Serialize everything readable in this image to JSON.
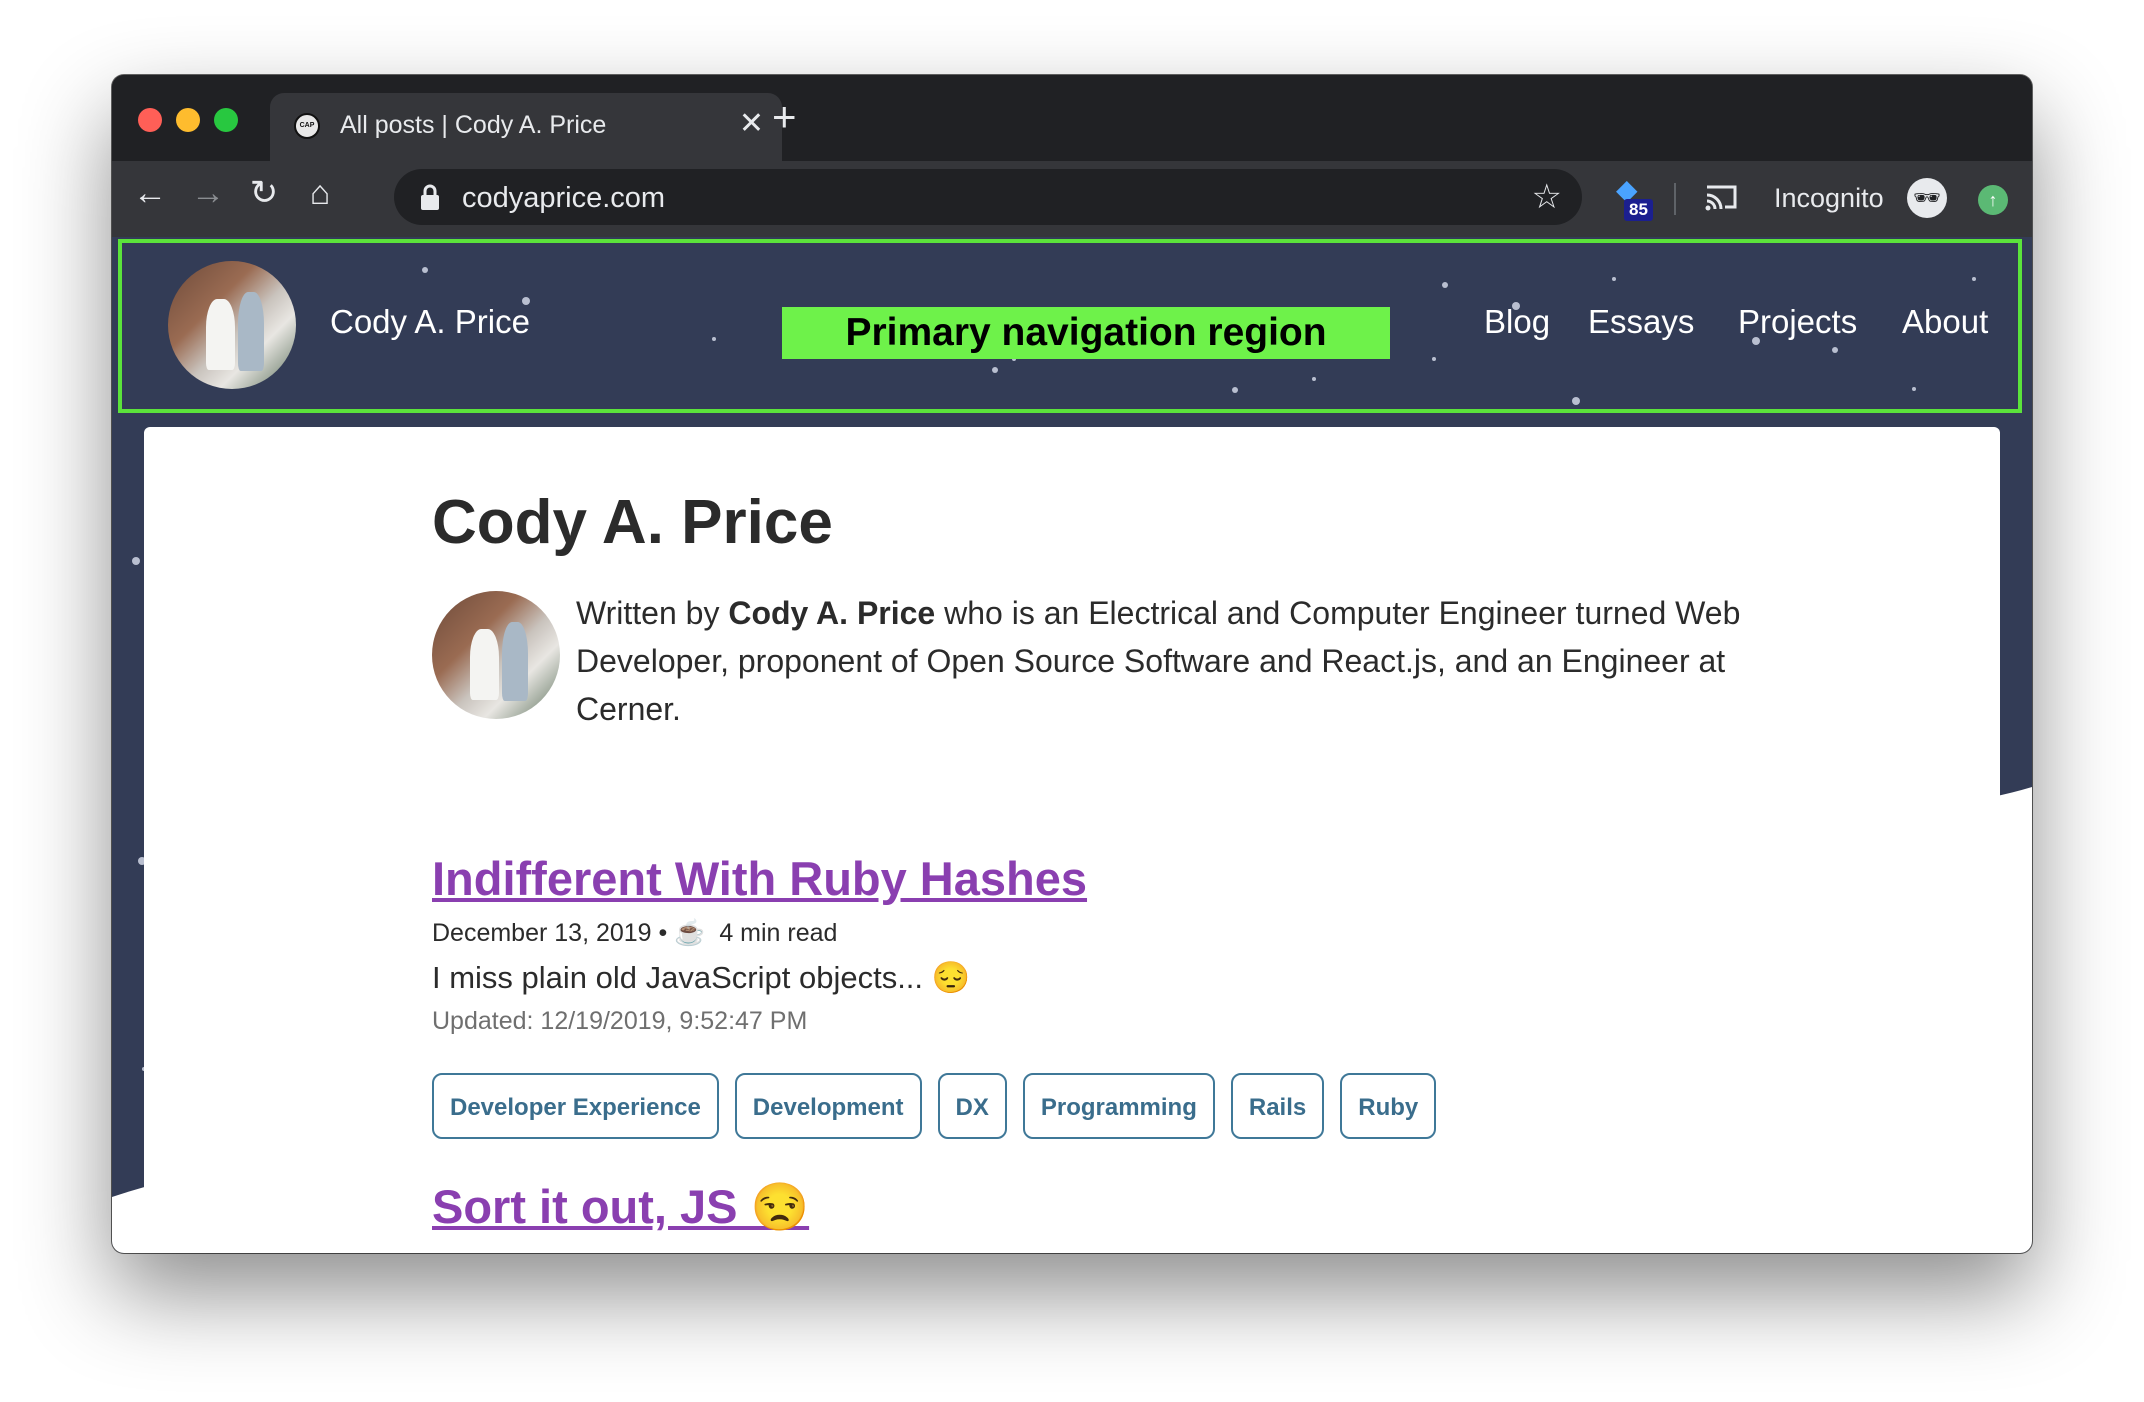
{
  "browser": {
    "tab_title": "All posts | Cody A. Price",
    "favicon_text": "CAP",
    "close_tab_icon": "close-icon",
    "new_tab_icon": "plus-icon",
    "url": "codyaprice.com",
    "extension_badge": "85",
    "incognito_label": "Incognito"
  },
  "nav": {
    "site_name": "Cody A. Price",
    "region_label": "Primary navigation region",
    "links": [
      "Blog",
      "Essays",
      "Projects",
      "About"
    ],
    "highlight_color": "#5be33b"
  },
  "page": {
    "title": "Cody A. Price",
    "bio_prefix": "Written by ",
    "bio_name": "Cody A. Price",
    "bio_suffix": " who is an Electrical and Computer Engineer turned Web Developer, proponent of Open Source Software and React.js, and an Engineer at Cerner."
  },
  "posts": [
    {
      "title": "Indifferent With Ruby Hashes",
      "date": "December 13, 2019",
      "separator": "•",
      "read_icon": "☕",
      "read_time": "4 min read",
      "excerpt": "I miss plain old JavaScript objects... 😔",
      "updated": "Updated: 12/19/2019, 9:52:47 PM",
      "tags": [
        "Developer Experience",
        "Development",
        "DX",
        "Programming",
        "Rails",
        "Ruby"
      ]
    },
    {
      "title": "Sort it out, JS 😒"
    }
  ],
  "colors": {
    "header_bg": "#333c56",
    "link_purple": "#8a3fb0",
    "tag_border": "#3f7898"
  }
}
